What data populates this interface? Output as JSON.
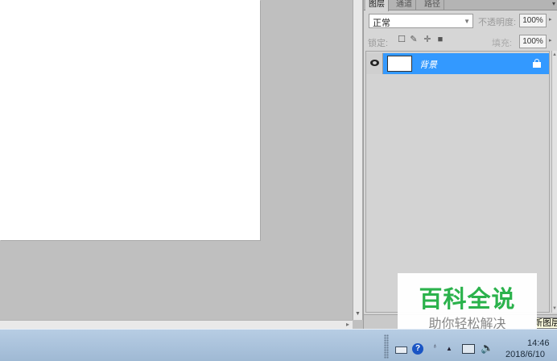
{
  "panel": {
    "tabs": [
      {
        "label": "图层"
      },
      {
        "label": "通道"
      },
      {
        "label": "路径"
      }
    ],
    "blend_mode": "正常",
    "opacity_label": "不透明度:",
    "opacity_value": "100%",
    "lock_label": "锁定:",
    "fill_label": "填充:",
    "fill_value": "100%",
    "layers": [
      {
        "name": "背景",
        "visible": true,
        "locked": true,
        "selected": true
      }
    ],
    "tooltip": "新图层"
  },
  "watermark": {
    "title": "百科全说",
    "subtitle": "助你轻松解决"
  },
  "taskbar": {
    "help_icon_glyph": "?",
    "time": "14:46",
    "date": "2018/6/10"
  },
  "colors": {
    "selected_layer": "#3399ff",
    "watermark_title": "#2bb24c",
    "workspace": "#bfbfbf",
    "taskbar": "#b7cde4"
  }
}
